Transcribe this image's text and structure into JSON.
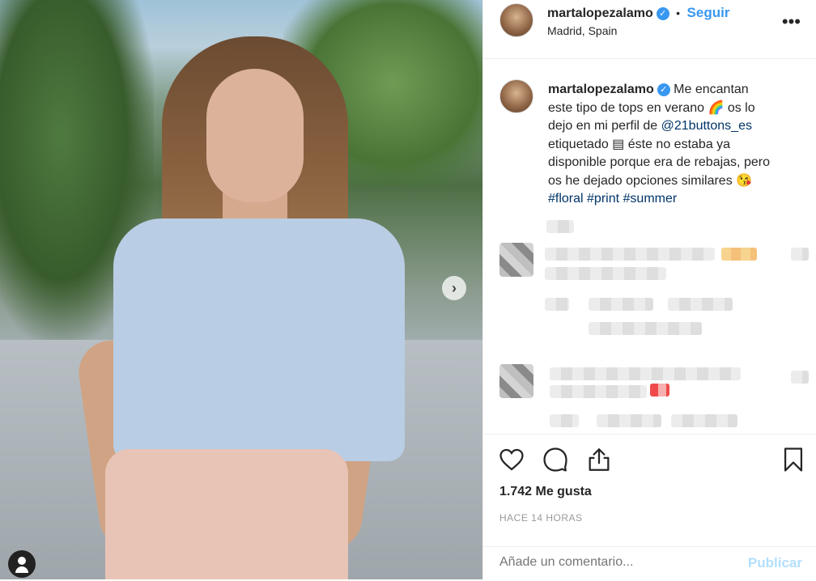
{
  "post": {
    "author": "martalopezalamo",
    "follow_label": "Seguir",
    "separator": "•",
    "location": "Madrid, Spain",
    "more_label": "•••",
    "caption_lines": [
      "Me encantan",
      "este tipo de tops en verano 🌈 os lo",
      "dejo en mi perfil de",
      "etiquetado ▤ éste no estaba ya",
      "disponible porque era de rebajas, pero",
      "os he dejado opciones similares 😘"
    ],
    "mention": "@21buttons_es",
    "hashtags": [
      "#floral",
      "#print",
      "#summer"
    ],
    "likes": "1.742 Me gusta",
    "time": "HACE 14 HORAS",
    "comment_placeholder": "Añade un comentario...",
    "publish_label": "Publicar"
  },
  "icons": {
    "like": "heart-icon",
    "comment": "comment-bubble-icon",
    "share": "share-icon",
    "save": "bookmark-icon",
    "next": "chevron-right-icon",
    "tag": "user-tag-icon",
    "verified": "verified-badge-icon"
  },
  "colors": {
    "link": "#3897f0",
    "text": "#262626",
    "muted": "#999999",
    "publish_disabled": "#b2dffc",
    "mention": "#003569"
  }
}
